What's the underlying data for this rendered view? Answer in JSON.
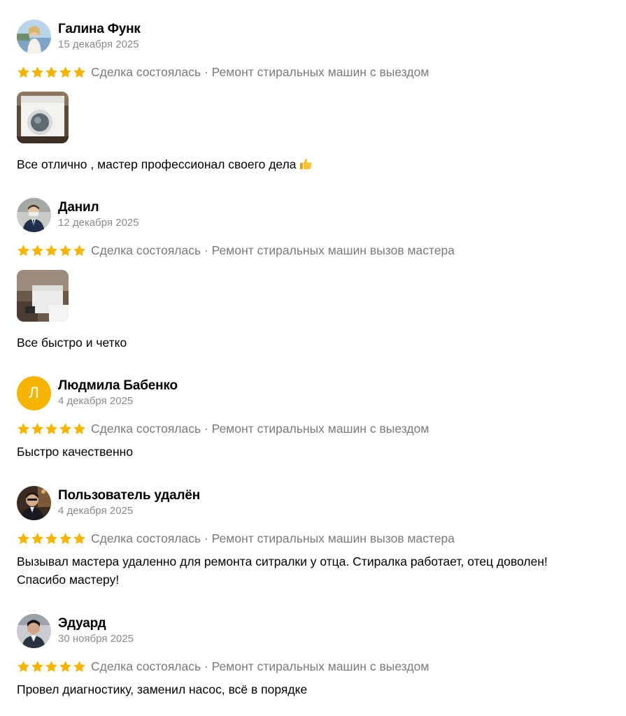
{
  "reviews": [
    {
      "author": "Галина Функ",
      "date": "15 декабря 2025",
      "rating": 5,
      "meta": "Сделка состоялась · Ремонт стиральных машин с выездом",
      "has_photo": true,
      "text": "Все отлично , мастер профессионал своего дела",
      "text_emoji": "thumbs-up-icon"
    },
    {
      "author": "Данил",
      "date": "12 декабря 2025",
      "rating": 5,
      "meta": "Сделка состоялась · Ремонт стиральных машин вызов мастера",
      "has_photo": true,
      "text": "Все быстро и четко"
    },
    {
      "author": "Людмила Бабенко",
      "avatar_letter": "Л",
      "date": "4 декабря 2025",
      "rating": 5,
      "meta": "Сделка состоялась · Ремонт стиральных машин с выездом",
      "has_photo": false,
      "text": "Быстро качественно"
    },
    {
      "author": "Пользователь удалён",
      "date": "4 декабря 2025",
      "rating": 5,
      "meta": "Сделка состоялась · Ремонт стиральных машин вызов мастера",
      "has_photo": false,
      "text_lines": [
        "Вызывал мастера удаленно для ремонта ситралки у отца. Стиралка работает, отец доволен!",
        "Спасибо мастеру!"
      ]
    },
    {
      "author": "Эдуард",
      "date": "30 ноября 2025",
      "rating": 5,
      "meta": "Сделка состоялась · Ремонт стиральных машин с выездом",
      "has_photo": false,
      "text": "Провел диагностику, заменил насос, всё в порядке"
    }
  ],
  "colors": {
    "star": "#f5b400",
    "avatar_letter_bg": "#f5b400",
    "meta_text": "#7a7a7a",
    "date_text": "#8a8a8a"
  }
}
